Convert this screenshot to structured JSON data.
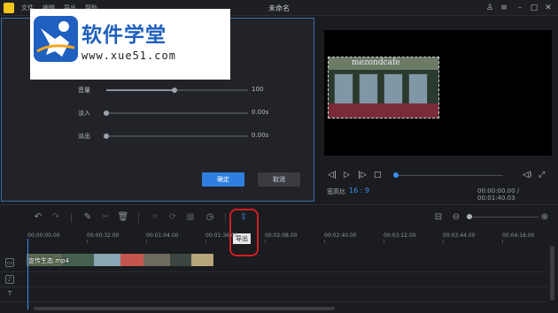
{
  "window": {
    "title": "未命名",
    "menu": [
      "文件",
      "编辑",
      "导出",
      "帮助"
    ]
  },
  "editor": {
    "sliders": [
      {
        "label": "音量",
        "value": "100",
        "level": 0.48
      },
      {
        "label": "淡入",
        "value": "0.00s",
        "level": 0.0
      },
      {
        "label": "淡出",
        "value": "0.00s",
        "level": 0.0
      }
    ],
    "ok_label": "确定",
    "cancel_label": "取消"
  },
  "watermark": {
    "title": "软件学堂",
    "url": "www.xue51.com"
  },
  "preview": {
    "video_sign": "mezondcafe",
    "aspect_label": "宽高比",
    "aspect_value": "16 : 9",
    "time_readout": "00:00:00.00 / 00:01:40.03"
  },
  "toolbar": {
    "export_tooltip": "导出"
  },
  "timeline": {
    "ticks": [
      "00:00:00.00",
      "00:00:32.00",
      "00:01:04.00",
      "00:01:36.00",
      "00:02:08.00",
      "00:02:40.00",
      "00:03:12.00",
      "00:03:44.00",
      "00:04:16.00"
    ],
    "clip_name": "宣传生态.mp4"
  },
  "colors": {
    "accent": "#2f7fe0",
    "highlight": "#d01f1f",
    "panel_border": "#3c6ea8"
  }
}
